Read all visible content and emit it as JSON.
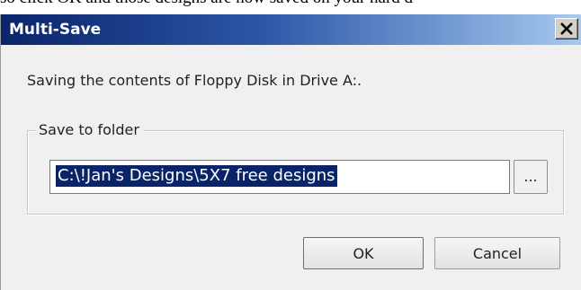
{
  "background_text": "so click OK and those designs are now saved on your hard d",
  "dialog": {
    "title": "Multi-Save",
    "close_icon": "close-icon",
    "message": "Saving the contents of Floppy Disk in Drive A:.",
    "group_label": "Save to folder",
    "folder_path": "C:\\!Jan's Designs\\5X7 free designs",
    "browse_label": "...",
    "ok_label": "OK",
    "cancel_label": "Cancel"
  },
  "colors": {
    "titlebar_start": "#0a246a",
    "titlebar_end": "#a6caf0",
    "selection": "#0a246a",
    "dialog_bg": "#f0f0f0"
  }
}
